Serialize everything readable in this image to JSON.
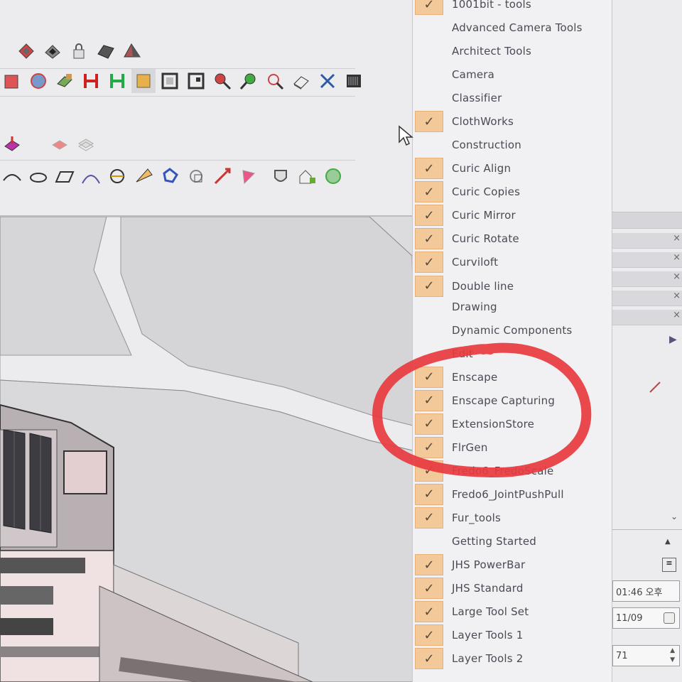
{
  "toolbars": {
    "row1": [
      "section-plane-icon",
      "section-fill-icon",
      "lock-icon",
      "shadow-icon",
      "pyramid-icon"
    ],
    "row2": [
      "component-icon",
      "outliner-icon",
      "layers-icon",
      "flip-x-icon",
      "flip-y-icon",
      "hide-icon",
      "box-icon",
      "frame-icon",
      "zoom-icon",
      "zoom-in-icon",
      "zoom-window-icon",
      "eraser-icon",
      "close-x-icon",
      "barcode-icon"
    ],
    "row3": [
      "push-pull-icon",
      "paint-icon",
      "stack-icon"
    ],
    "row4": [
      "arc-icon",
      "ellipse-icon",
      "parallelogram-icon",
      "curve-icon",
      "sphere-icon",
      "cone-icon",
      "rotate-icon",
      "copy-icon",
      "move-arrow-icon",
      "flag-icon",
      "shield-icon",
      "house-icon",
      "globe-icon"
    ]
  },
  "menu": {
    "items": [
      {
        "label": "1001bit - tools",
        "checked": true
      },
      {
        "label": "Advanced Camera Tools",
        "checked": false
      },
      {
        "label": "Architect Tools",
        "checked": false
      },
      {
        "label": "Camera",
        "checked": false
      },
      {
        "label": "Classifier",
        "checked": false
      },
      {
        "label": "ClothWorks",
        "checked": true
      },
      {
        "label": "Construction",
        "checked": false
      },
      {
        "label": "Curic Align",
        "checked": true
      },
      {
        "label": "Curic Copies",
        "checked": true
      },
      {
        "label": "Curic Mirror",
        "checked": true
      },
      {
        "label": "Curic Rotate",
        "checked": true
      },
      {
        "label": "Curviloft",
        "checked": true
      },
      {
        "label": "Double line",
        "checked": true
      },
      {
        "label": "Drawing",
        "checked": false
      },
      {
        "label": "Dynamic Components",
        "checked": false
      },
      {
        "label": "Edit",
        "checked": false
      },
      {
        "label": "Enscape",
        "checked": true
      },
      {
        "label": "Enscape Capturing",
        "checked": true
      },
      {
        "label": "ExtensionStore",
        "checked": true
      },
      {
        "label": "FlrGen",
        "checked": true
      },
      {
        "label": "Fredo6_FredoScale",
        "checked": true
      },
      {
        "label": "Fredo6_JointPushPull",
        "checked": true
      },
      {
        "label": "Fur_tools",
        "checked": true
      },
      {
        "label": "Getting Started",
        "checked": false
      },
      {
        "label": "JHS PowerBar",
        "checked": true
      },
      {
        "label": "JHS Standard",
        "checked": true
      },
      {
        "label": "Large Tool Set",
        "checked": true
      },
      {
        "label": "Layer Tools 1",
        "checked": true
      },
      {
        "label": "Layer Tools 2",
        "checked": true
      }
    ],
    "check_glyph": "✓"
  },
  "right_panel": {
    "close_glyph": "×",
    "time_value": "01:46 오후",
    "date_value": "11/09",
    "number_value": "71"
  },
  "colors": {
    "check_bg": "#f4c99a",
    "annotation": "#e8393f"
  }
}
